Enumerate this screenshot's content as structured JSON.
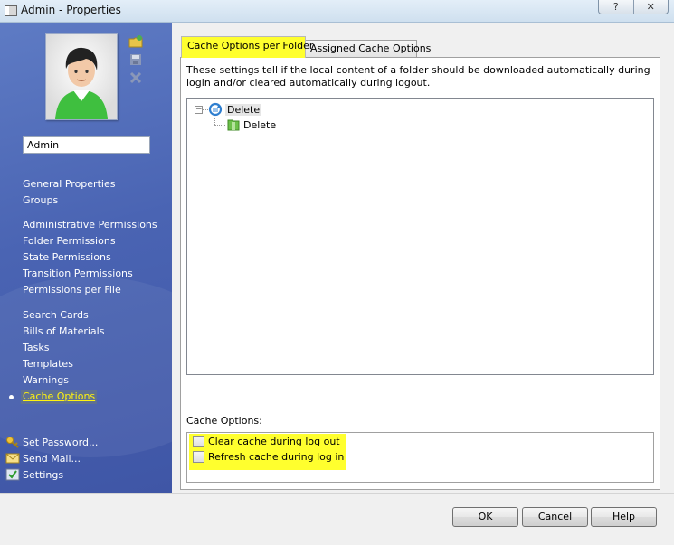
{
  "window": {
    "title": "Admin - Properties",
    "help_glyph": "?",
    "close_glyph": "✕"
  },
  "colors": {
    "sidebar": "#4a64b3",
    "highlight": "#ffff2e",
    "active_nav_text": "#fff200"
  },
  "sidebar": {
    "user_name": "Admin",
    "tools": [
      "folder-add-icon",
      "save-icon",
      "delete-icon"
    ],
    "nav_groups": [
      [
        "General Properties",
        "Groups"
      ],
      [
        "Administrative Permissions",
        "Folder Permissions",
        "State Permissions",
        "Transition Permissions",
        "Permissions per File"
      ],
      [
        "Search Cards",
        "Bills of Materials",
        "Tasks",
        "Templates",
        "Warnings",
        "Cache Options"
      ]
    ],
    "active_item": "Cache Options",
    "actions": [
      {
        "label": "Set Password...",
        "icon": "key-icon"
      },
      {
        "label": "Send Mail...",
        "icon": "mail-icon"
      },
      {
        "label": "Settings",
        "icon": "settings-check-icon"
      }
    ]
  },
  "tabs": [
    {
      "label": "Cache Options per Folder",
      "active": true
    },
    {
      "label": "Assigned Cache Options",
      "active": false
    }
  ],
  "panel": {
    "description": "These settings tell if the local content of a folder should be downloaded automatically during login and/or cleared automatically during logout.",
    "tree": {
      "root_label": "Delete",
      "root_expander": "−",
      "child_label": "Delete"
    },
    "cache_options_label": "Cache Options:",
    "options": [
      {
        "label": "Clear cache during log out",
        "checked": false
      },
      {
        "label": "Refresh cache during log in",
        "checked": false
      }
    ]
  },
  "buttons": {
    "ok": "OK",
    "cancel": "Cancel",
    "help": "Help"
  }
}
